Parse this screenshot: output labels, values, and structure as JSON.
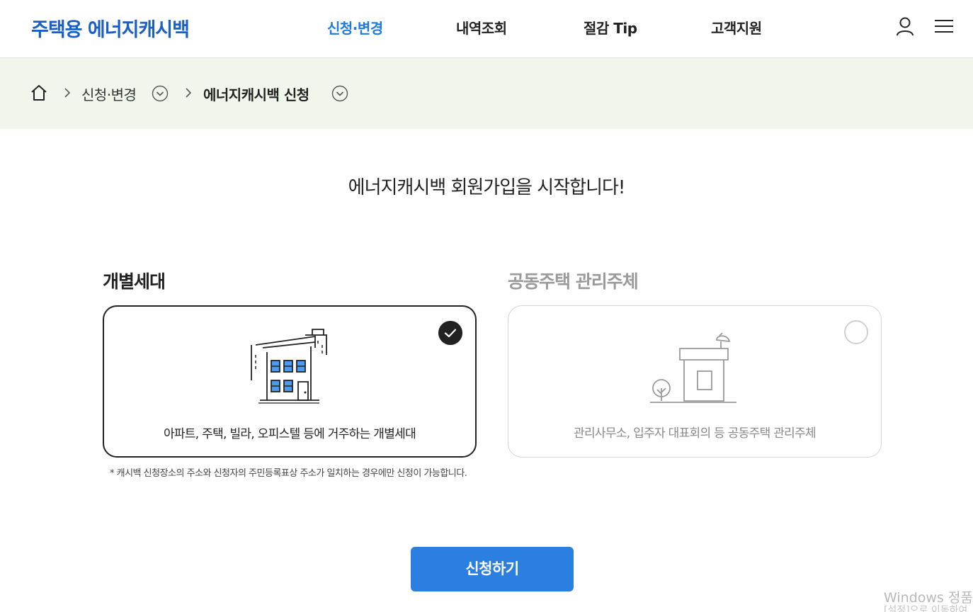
{
  "header": {
    "logo": "주택용 에너지캐시백",
    "nav": [
      {
        "label": "신청·변경",
        "active": true
      },
      {
        "label": "내역조회",
        "active": false
      },
      {
        "label": "절감 Tip",
        "active": false
      },
      {
        "label": "고객지원",
        "active": false
      }
    ],
    "icons": [
      "user-icon",
      "hamburger-menu-icon"
    ]
  },
  "breadcrumb": {
    "items": [
      {
        "label": "신청·변경"
      },
      {
        "label": "에너지캐시백 신청"
      }
    ]
  },
  "main": {
    "title": "에너지캐시백 회원가입을 시작합니다!",
    "options": [
      {
        "title": "개별세대",
        "description": "아파트, 주택, 빌라, 오피스텔 등에 거주하는 개별세대",
        "selected": true
      },
      {
        "title": "공동주택 관리주체",
        "description": "관리사무소, 입주자 대표회의 등 공동주택 관리주체",
        "selected": false
      }
    ],
    "note": "* 캐시백 신청장소의 주소와 신청자의 주민등록표상 주소가 일치하는 경우에만 신청이 가능합니다.",
    "submit_label": "신청하기"
  },
  "os_watermark": {
    "line1": "Windows 정품",
    "line2": "[설정]으로 이동하여"
  },
  "colors": {
    "brand": "#1a5ec7",
    "nav_active": "#1f7ae0",
    "button": "#2a7fe0",
    "breadcrumb_bg": "#f1f6ec"
  }
}
